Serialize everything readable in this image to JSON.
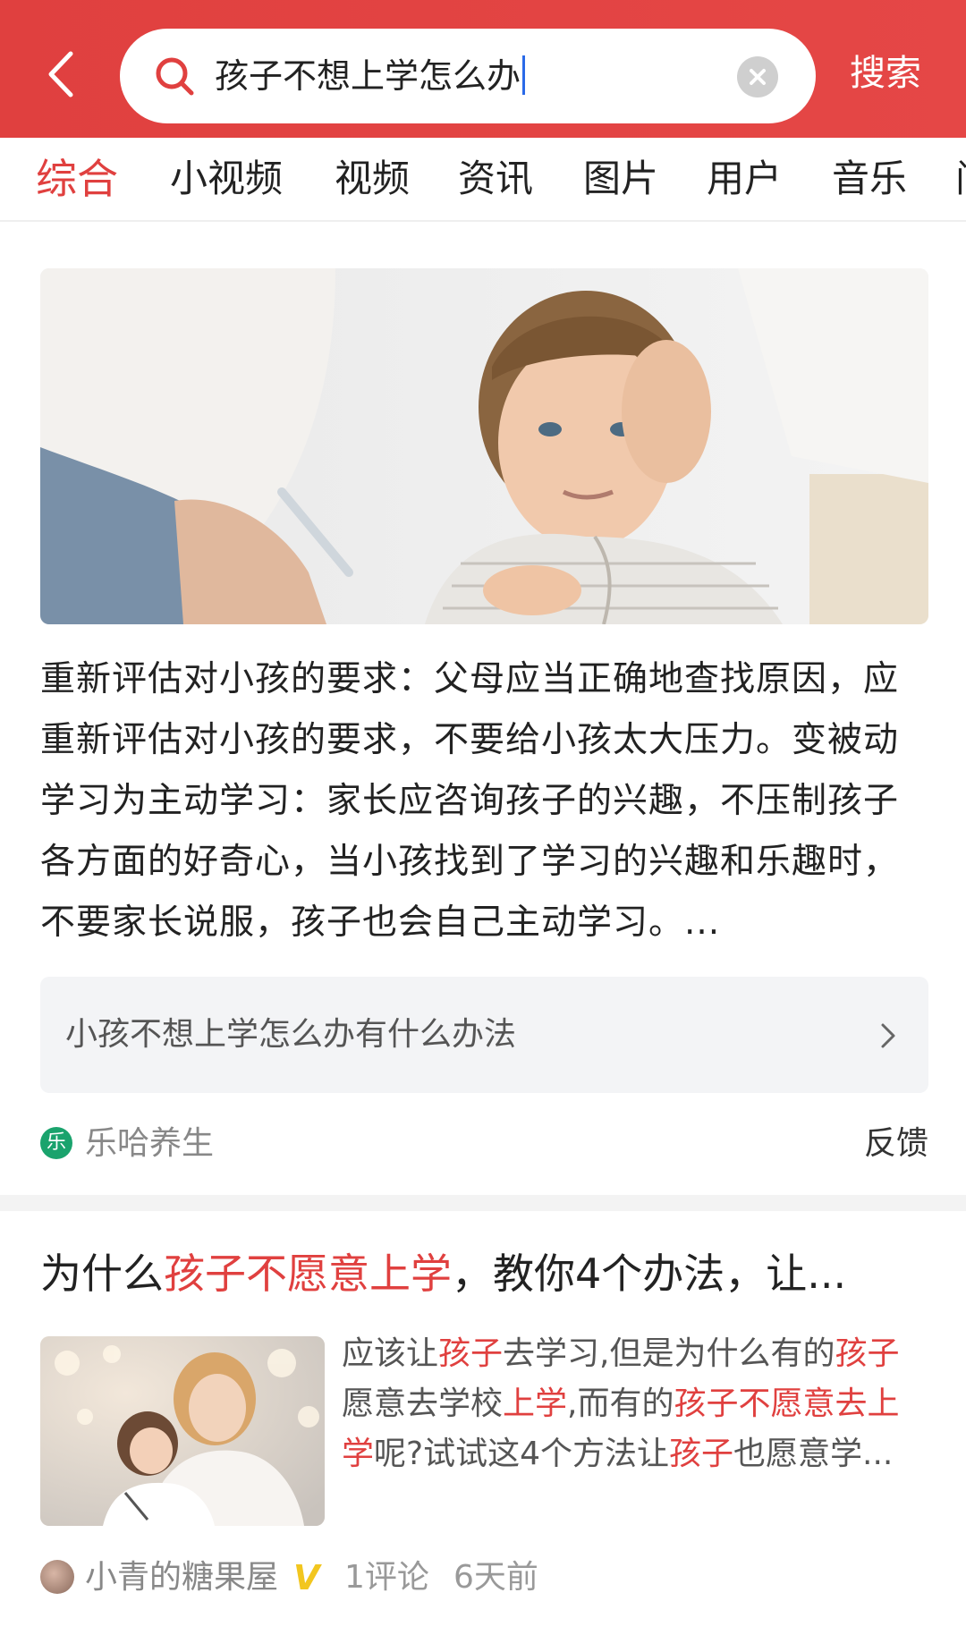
{
  "header": {
    "search_query": "孩子不想上学怎么办",
    "search_button": "搜索",
    "back_icon": "chevron-left-icon",
    "search_icon": "search-icon",
    "clear_icon": "clear-icon",
    "bg_color": "#e0403f"
  },
  "tabs": [
    {
      "label": "综合",
      "active": true
    },
    {
      "label": "小视频"
    },
    {
      "label": "视频"
    },
    {
      "label": "资讯"
    },
    {
      "label": "图片"
    },
    {
      "label": "用户"
    },
    {
      "label": "音乐"
    },
    {
      "label": "问"
    }
  ],
  "card1": {
    "summary": "重新评估对小孩的要求：父母应当正确地查找原因，应重新评估对小孩的要求，不要给小孩太大压力。变被动学习为主动学习：家长应咨询孩子的兴趣，不压制孩子各方面的好奇心，当小孩找到了学习的兴趣和乐趣时，不要家长说服，孩子也会自己主动学习。...",
    "related_query": "小孩不想上学怎么办有什么办法",
    "source_icon": "乐",
    "source_name": "乐哈养生",
    "feedback": "反馈"
  },
  "card2": {
    "title_parts": [
      "为什么",
      "孩子不愿意上学",
      "，教你4个办法，让..."
    ],
    "snippet_parts": [
      "应该让",
      "孩子",
      "去学习,但是为什么有的",
      "孩子",
      "愿意去学校",
      "上学",
      ",而有的",
      "孩子不愿意去上学",
      "呢?试试这4个方法让",
      "孩子",
      "也愿意学..."
    ],
    "author": "小青的糖果屋",
    "verified_badge": "V",
    "comments": "1评论",
    "time": "6天前"
  },
  "colors": {
    "accent": "#e0403f",
    "verified": "#f2c61f",
    "source_green": "#1aa36d"
  }
}
